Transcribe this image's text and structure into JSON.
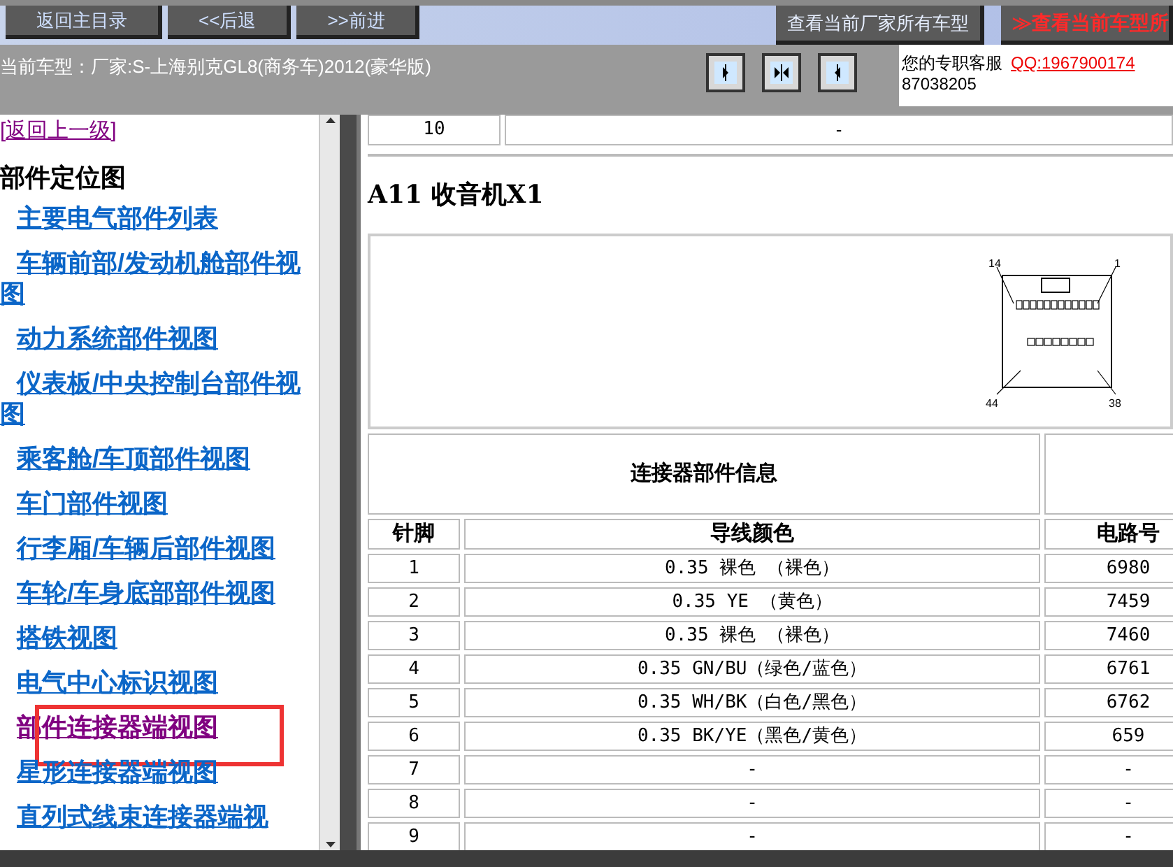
{
  "toolbar": {
    "buttons": [
      {
        "label": "返回主目录"
      },
      {
        "label": "<<后退"
      },
      {
        "label": ">>前进"
      }
    ],
    "right_buttons": [
      {
        "label": "查看当前厂家所有车型",
        "kind": "normal"
      },
      {
        "label": "≫查看当前车型所",
        "kind": "red"
      }
    ]
  },
  "info_bar": {
    "car": "当前车型：厂家:S-上海别克GL8(商务车)2012(豪华版)",
    "service_label": "您的专职客服",
    "qq": "QQ:1967900174",
    "phone": "87038205"
  },
  "sidebar": {
    "back_link": {
      "label": "[返回上一级]",
      "visited": true
    },
    "heading": "部件定位图",
    "items": [
      {
        "label": "主要电气部件列表",
        "visited": false,
        "highlighted": false
      },
      {
        "label": "车辆前部/发动机舱部件视图",
        "visited": false,
        "highlighted": false
      },
      {
        "label": "动力系统部件视图",
        "visited": false,
        "highlighted": false
      },
      {
        "label": "仪表板/中央控制台部件视图",
        "visited": false,
        "highlighted": false
      },
      {
        "label": "乘客舱/车顶部件视图",
        "visited": false,
        "highlighted": false
      },
      {
        "label": "车门部件视图",
        "visited": false,
        "highlighted": false
      },
      {
        "label": "行李厢/车辆后部件视图",
        "visited": false,
        "highlighted": false
      },
      {
        "label": "车轮/车身底部部件视图",
        "visited": false,
        "highlighted": false
      },
      {
        "label": "搭铁视图",
        "visited": false,
        "highlighted": false
      },
      {
        "label": "电气中心标识视图",
        "visited": false,
        "highlighted": false
      },
      {
        "label": "部件连接器端视图",
        "visited": true,
        "highlighted": true
      },
      {
        "label": "星形连接器端视图",
        "visited": false,
        "highlighted": false
      },
      {
        "label": "直列式线束连接器端视",
        "visited": false,
        "highlighted": false
      }
    ]
  },
  "previous_row": {
    "pin": "10",
    "wire": "-"
  },
  "section_title": "A11 收音机X1",
  "connector_labels": [
    "14",
    "1",
    "44",
    "38"
  ],
  "table": {
    "group_header": "连接器部件信息",
    "columns": [
      "针脚",
      "导线颜色",
      "电路号"
    ],
    "rows": [
      [
        "1",
        "0.35 裸色 （裸色）",
        "6980"
      ],
      [
        "2",
        "0.35 YE （黄色）",
        "7459"
      ],
      [
        "3",
        "0.35 裸色 （裸色）",
        "7460"
      ],
      [
        "4",
        "0.35 GN/BU（绿色/蓝色）",
        "6761"
      ],
      [
        "5",
        "0.35 WH/BK（白色/黑色）",
        "6762"
      ],
      [
        "6",
        "0.35 BK/YE（黑色/黄色）",
        "659"
      ],
      [
        "7",
        "-",
        "-"
      ],
      [
        "8",
        "-",
        "-"
      ],
      [
        "9",
        "-",
        "-"
      ]
    ]
  }
}
